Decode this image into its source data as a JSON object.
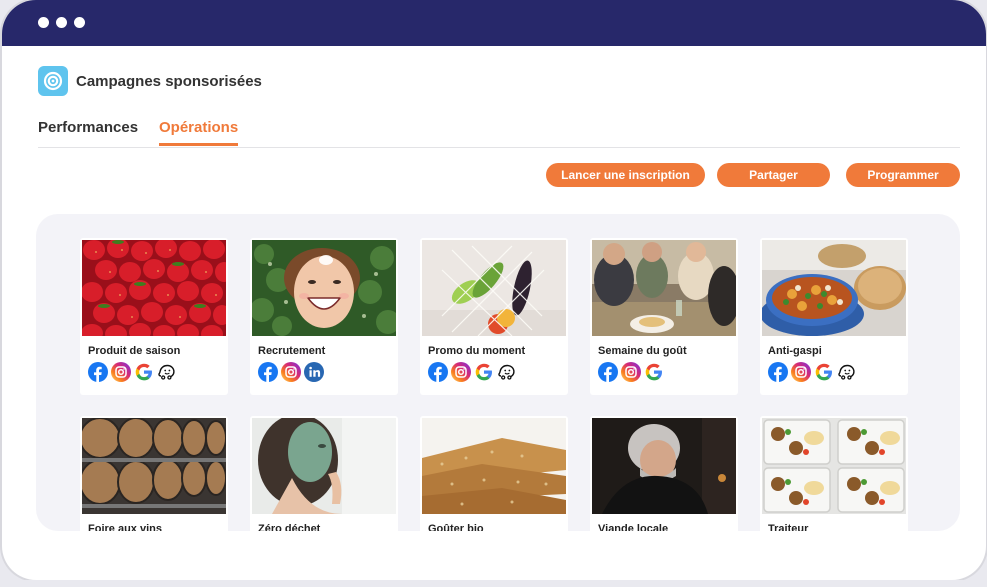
{
  "header": {
    "title": "Campagnes sponsorisées"
  },
  "tabs": [
    {
      "label": "Performances"
    },
    {
      "label": "Opérations"
    }
  ],
  "actions": {
    "register": "Lancer une inscription",
    "share": "Partager",
    "schedule": "Programmer"
  },
  "accent_color": "#f07a3a",
  "titlebar_color": "#27286a",
  "campaigns": [
    {
      "title": "Produit de saison",
      "networks": [
        "facebook-icon",
        "instagram-icon",
        "google-icon",
        "waze-icon"
      ]
    },
    {
      "title": "Recrutement",
      "networks": [
        "facebook-icon",
        "instagram-icon",
        "linkedin-icon"
      ]
    },
    {
      "title": "Promo du moment",
      "networks": [
        "facebook-icon",
        "instagram-icon",
        "google-icon",
        "waze-icon"
      ]
    },
    {
      "title": "Semaine du goût",
      "networks": [
        "facebook-icon",
        "instagram-icon",
        "google-icon"
      ]
    },
    {
      "title": "Anti-gaspi",
      "networks": [
        "facebook-icon",
        "instagram-icon",
        "google-icon",
        "waze-icon"
      ]
    },
    {
      "title": "Foire aux vins"
    },
    {
      "title": "Zéro déchet"
    },
    {
      "title": "Goûter bio"
    },
    {
      "title": "Viande locale"
    },
    {
      "title": "Traiteur"
    }
  ]
}
